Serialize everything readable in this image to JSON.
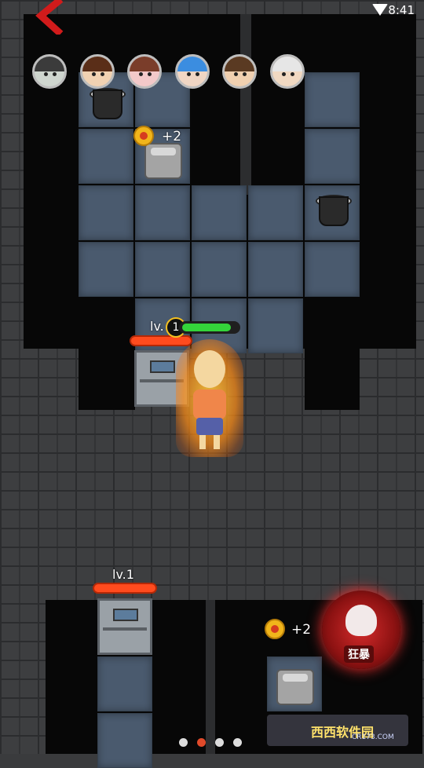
{
  "status_bar": {
    "time": "8:41"
  },
  "avatars": [
    {
      "name": "ghost-girl",
      "hair": "#3b3b3b",
      "skin": "#cfd6cf"
    },
    {
      "name": "man-sunglasses",
      "hair": "#5a2e18",
      "skin": "#f1d2b2"
    },
    {
      "name": "pink-girl",
      "hair": "#7a3d2a",
      "skin": "#f3c9c9"
    },
    {
      "name": "blue-hair-girl",
      "hair": "#3b8de0",
      "skin": "#f0d6c4"
    },
    {
      "name": "brown-hair-man",
      "hair": "#5a3a22",
      "skin": "#f0d0b0"
    },
    {
      "name": "old-man-glasses",
      "hair": "#e6e6e6",
      "skin": "#f1d9c2"
    }
  ],
  "rewards": [
    {
      "label": "+2"
    },
    {
      "label": "+2"
    }
  ],
  "doors": [
    {
      "level": "lv."
    },
    {
      "level": "lv.1"
    }
  ],
  "player": {
    "level": "1",
    "hp": 0.8
  },
  "rage_button": {
    "label": "狂暴"
  },
  "pager": {
    "count": 4,
    "active": 1
  },
  "watermark": {
    "brand": "西西软件园",
    "url": "CR173.COM"
  },
  "colors": {
    "tile": "#4a5a6e",
    "hp_red": "#ff4b1e",
    "hp_green": "#34d43a"
  }
}
